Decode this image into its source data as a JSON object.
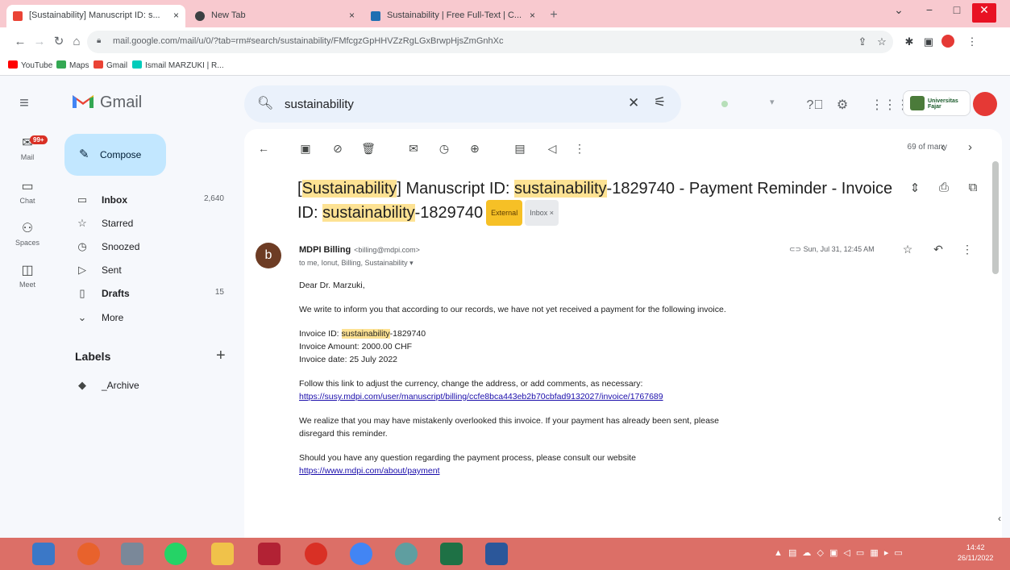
{
  "browser": {
    "tabs": [
      {
        "title": "[Sustainability] Manuscript ID: s...",
        "close": "×",
        "active": true
      },
      {
        "title": "New Tab",
        "close": "×",
        "active": false
      },
      {
        "title": "Sustainability | Free Full-Text | C...",
        "close": "×",
        "active": false
      }
    ],
    "new_tab": "+",
    "window": {
      "minimize": "−",
      "maximize": "□",
      "close": "✕",
      "profile": "⌄"
    },
    "url": "mail.google.com/mail/u/0/?tab=rm#search/sustainability/FMfcgzGpHHVZzRgLGxBrwpHjsZmGnhXc",
    "bookmarks": [
      "YouTube",
      "Maps",
      "Gmail",
      "Ismail MARZUKI | R..."
    ],
    "colors": {
      "tab_strip": "#f8c9cf",
      "taskbar": "#dc6f67"
    }
  },
  "gmail": {
    "app_name": "Gmail",
    "search_value": "sustainability",
    "compose_label": "Compose",
    "rail": [
      {
        "label": "Mail",
        "icon": "mail-icon",
        "badge": "99+"
      },
      {
        "label": "Chat",
        "icon": "chat-icon"
      },
      {
        "label": "Spaces",
        "icon": "spaces-icon"
      },
      {
        "label": "Meet",
        "icon": "meet-icon"
      }
    ],
    "folders": [
      {
        "label": "Inbox",
        "count": "2,640",
        "bold": true
      },
      {
        "label": "Starred",
        "count": ""
      },
      {
        "label": "Snoozed",
        "count": ""
      },
      {
        "label": "Sent",
        "count": ""
      },
      {
        "label": "Drafts",
        "count": "15",
        "bold": true
      },
      {
        "label": "More",
        "count": ""
      }
    ],
    "labels_heading": "Labels",
    "labels": [
      "_Archive"
    ],
    "org_badge": "Universitas Fajar"
  },
  "email": {
    "pager_text": "69 of many",
    "subject_pre": "[",
    "subject_hl1": "Sustainability",
    "subject_mid1": "] Manuscript ID: ",
    "subject_hl2": "sustainability",
    "subject_mid2": "-1829740 - Payment Reminder - Invoice ID: ",
    "subject_hl3": "sustainability",
    "subject_end": "-1829740",
    "badge_external": "External",
    "badge_inbox": "Inbox ×",
    "sender_avatar": "b",
    "sender_name": "MDPI Billing",
    "sender_email": "<billing@mdpi.com>",
    "recipients": "to me, Ionut, Billing, Sustainability ▾",
    "date": "Sun, Jul 31, 12:45 AM",
    "greeting": "Dear Dr. Marzuki,",
    "para1": "We write to inform you that according to our records, we have not yet received a payment for the following invoice.",
    "invoice_id_label": "Invoice ID: ",
    "invoice_id_hl": "sustainability",
    "invoice_id_num": "-1829740",
    "invoice_amount": "Invoice Amount: 2000.00 CHF",
    "invoice_date": "Invoice date: 25 July 2022",
    "para2": "Follow this link to adjust the currency, change the address, or add comments, as necessary:",
    "link1": "https://susy.mdpi.com/user/manuscript/billing/ccfe8bca443eb2b70cbfad9132027/invoice/1767689",
    "para3": "We realize that you may have mistakenly overlooked this invoice. If your payment has already been sent, please disregard this reminder.",
    "para4": "Should you have any question regarding the payment process, please consult our website ",
    "link2": "https://www.mdpi.com/about/payment"
  },
  "taskbar": {
    "clock_time": "14:42",
    "clock_date": "26/11/2022",
    "tray": "▲ ▤ ☁ ◇ ▣ ◁ ▭ ▦ ▸ ▭"
  }
}
